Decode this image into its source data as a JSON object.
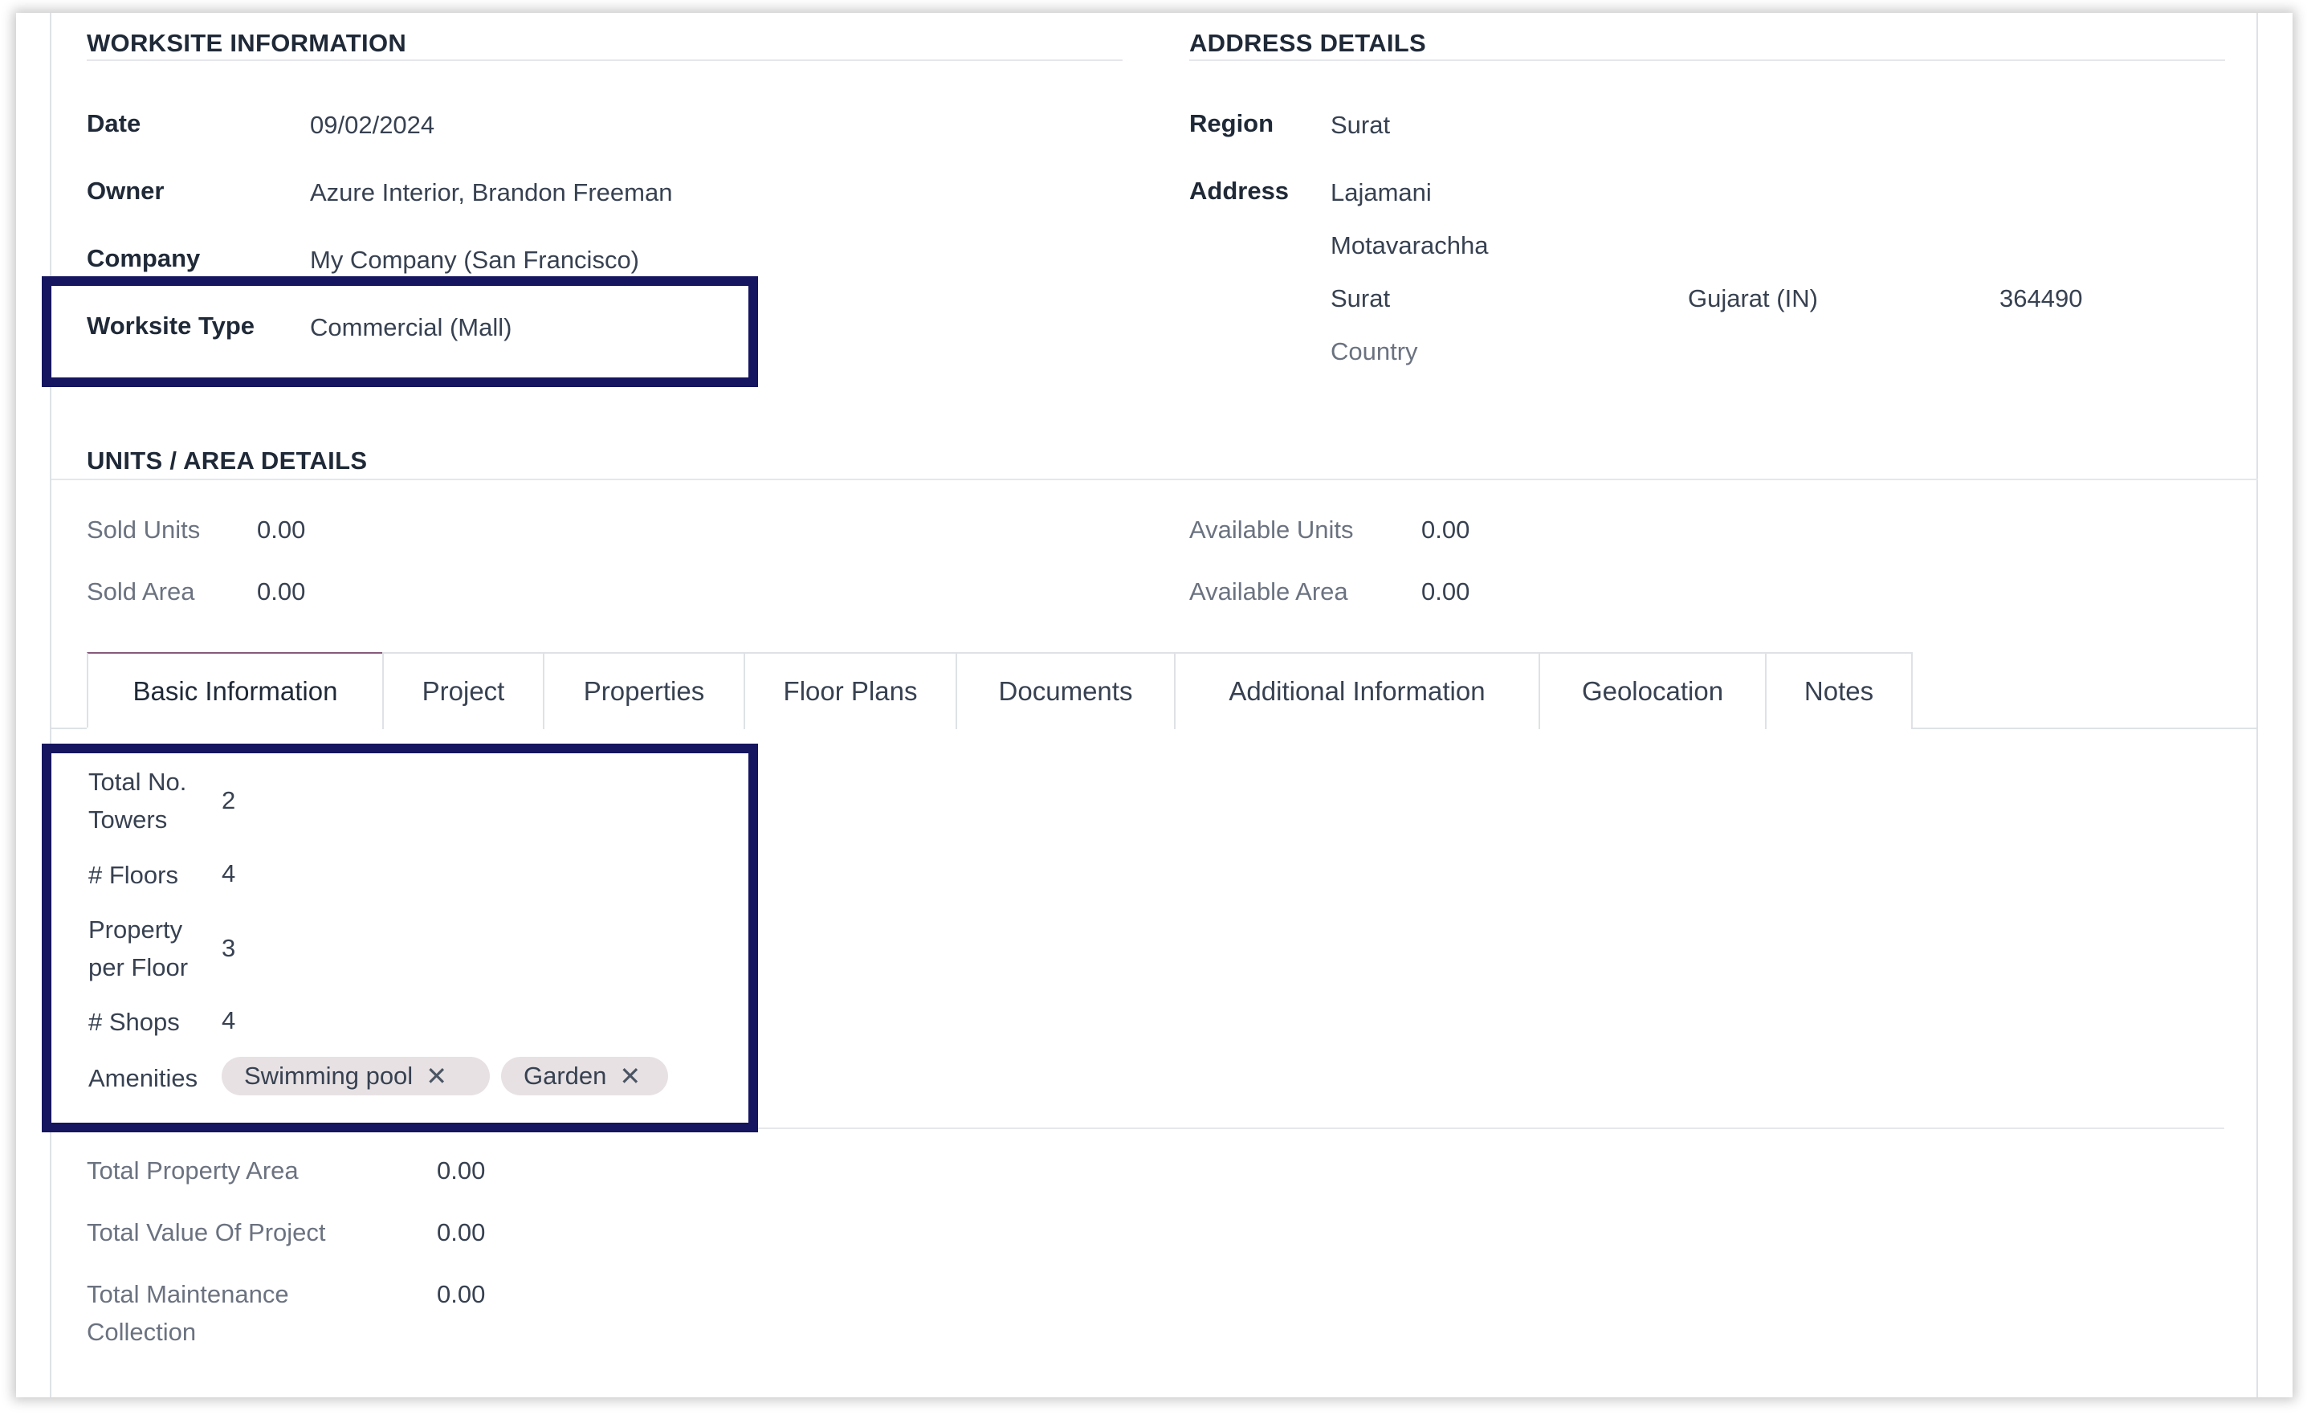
{
  "worksite": {
    "title": "WORKSITE INFORMATION",
    "date_label": "Date",
    "date_value": "09/02/2024",
    "owner_label": "Owner",
    "owner_value": "Azure Interior, Brandon Freeman",
    "company_label": "Company",
    "company_value": "My Company (San Francisco)",
    "type_label": "Worksite Type",
    "type_value": "Commercial (Mall)"
  },
  "address": {
    "title": "ADDRESS DETAILS",
    "region_label": "Region",
    "region_value": "Surat",
    "address_label": "Address",
    "street": "Lajamani",
    "street2": "Motavarachha",
    "city": "Surat",
    "state": "Gujarat (IN)",
    "zip": "364490",
    "country_placeholder": "Country"
  },
  "units": {
    "title": "UNITS / AREA DETAILS",
    "sold_units_label": "Sold Units",
    "sold_units_value": "0.00",
    "sold_area_label": "Sold Area",
    "sold_area_value": "0.00",
    "available_units_label": "Available Units",
    "available_units_value": "0.00",
    "available_area_label": "Available Area",
    "available_area_value": "0.00"
  },
  "tabs": [
    {
      "label": "Basic Information",
      "active": true
    },
    {
      "label": "Project"
    },
    {
      "label": "Properties"
    },
    {
      "label": "Floor Plans"
    },
    {
      "label": "Documents"
    },
    {
      "label": "Additional Information"
    },
    {
      "label": "Geolocation"
    },
    {
      "label": "Notes"
    }
  ],
  "basic": {
    "towers_label_1": "Total No.",
    "towers_label_2": "Towers",
    "towers_value": "2",
    "floors_label": "# Floors",
    "floors_value": "4",
    "ppf_label_1": "Property",
    "ppf_label_2": "per Floor",
    "ppf_value": "3",
    "shops_label": "# Shops",
    "shops_value": "4",
    "amenities_label": "Amenities",
    "amenities": [
      "Swimming pool",
      "Garden"
    ],
    "tag_remove_glyph": "✕"
  },
  "totals": {
    "property_area_label": "Total Property Area",
    "property_area_value": "0.00",
    "project_value_label": "Total Value Of Project",
    "project_value_value": "0.00",
    "maintenance_label_1": "Total Maintenance",
    "maintenance_label_2": "Collection",
    "maintenance_value": "0.00"
  },
  "colors": {
    "highlight_border": "#151560",
    "tab_active_top": "#875a7b",
    "tag_background": "#e7e1e3"
  }
}
